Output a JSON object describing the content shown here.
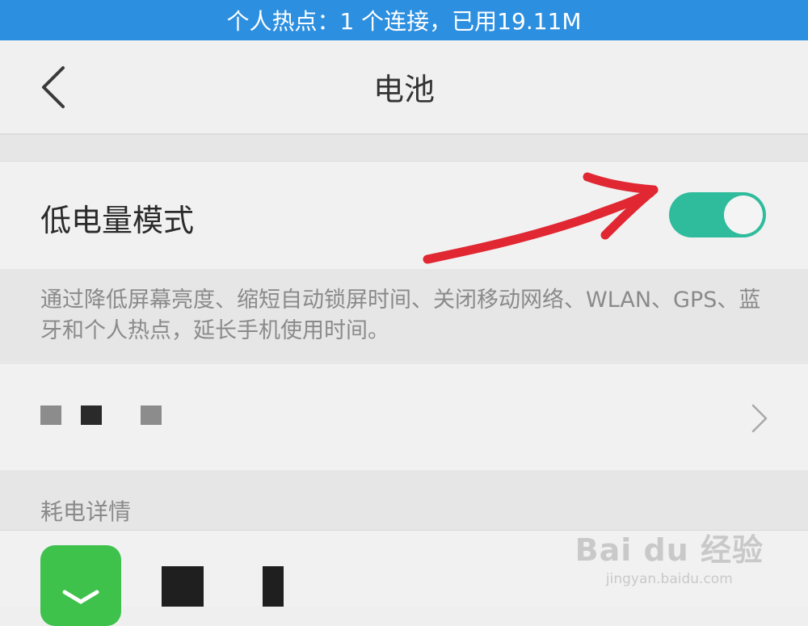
{
  "status_bar": {
    "hotspot_text": "个人热点：1 个连接，已用19.11M"
  },
  "header": {
    "title": "电池"
  },
  "low_power": {
    "label": "低电量模式",
    "enabled": true,
    "description": "通过降低屏幕亮度、缩短自动锁屏时间、关闭移动网络、WLAN、GPS、蓝牙和个人热点，延长手机使用时间。"
  },
  "section": {
    "title": "耗电详情"
  },
  "watermark": {
    "brand": "Bai du 经验",
    "url": "jingyan.baidu.com"
  },
  "colors": {
    "status_bar": "#2d8fe0",
    "switch_on": "#2fbc9c",
    "annotation": "#e02732",
    "app_icon": "#3ec24c"
  },
  "icons": [
    "chevron-left-icon",
    "chevron-right-icon",
    "toggle-switch",
    "red-arrow-annotation"
  ]
}
